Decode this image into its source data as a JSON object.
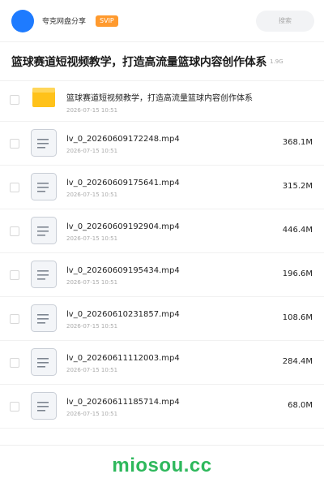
{
  "header": {
    "brand": "夸克网盘分享",
    "badge": "SVIP",
    "search_placeholder": "搜索"
  },
  "share": {
    "title": "篮球赛道短视频教学，打造高流量篮球内容创作体系",
    "total_size": "1.9G"
  },
  "items": [
    {
      "type": "folder",
      "name": "篮球赛道短视频教学，打造高流量篮球内容创作体系",
      "date": "2026-07-15 10:51",
      "size": ""
    },
    {
      "type": "file",
      "name": "lv_0_20260609172248.mp4",
      "date": "2026-07-15 10:51",
      "size": "368.1M"
    },
    {
      "type": "file",
      "name": "lv_0_20260609175641.mp4",
      "date": "2026-07-15 10:51",
      "size": "315.2M"
    },
    {
      "type": "file",
      "name": "lv_0_20260609192904.mp4",
      "date": "2026-07-15 10:51",
      "size": "446.4M"
    },
    {
      "type": "file",
      "name": "lv_0_20260609195434.mp4",
      "date": "2026-07-15 10:51",
      "size": "196.6M"
    },
    {
      "type": "file",
      "name": "lv_0_20260610231857.mp4",
      "date": "2026-07-15 10:51",
      "size": "108.6M"
    },
    {
      "type": "file",
      "name": "lv_0_20260611112003.mp4",
      "date": "2026-07-15 10:51",
      "size": "284.4M"
    },
    {
      "type": "file",
      "name": "lv_0_20260611185714.mp4",
      "date": "2026-07-15 10:51",
      "size": "68.0M"
    }
  ],
  "watermark": "miosou.cc",
  "colors": {
    "accent": "#1e7bff",
    "badge": "#ff9a2e",
    "folder": "#ffc21a",
    "watermark": "#2eb85c"
  },
  "icons": {
    "avatar": "avatar",
    "folder": "folder-icon",
    "file": "document-icon"
  }
}
